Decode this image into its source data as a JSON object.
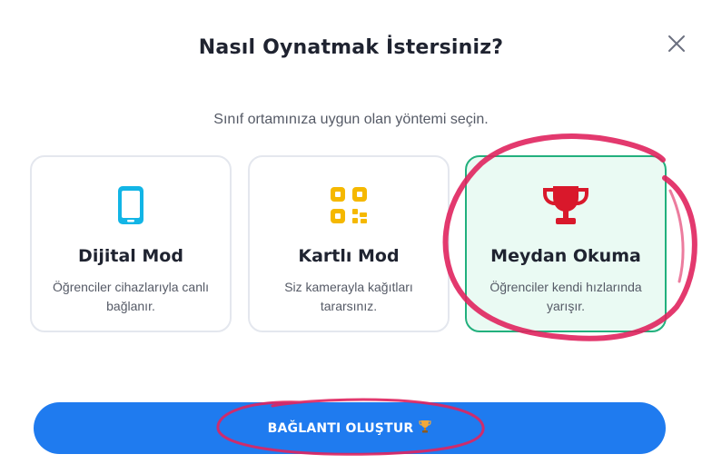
{
  "dialog": {
    "title": "Nasıl Oynatmak İstersiniz?",
    "subtitle": "Sınıf ortamınıza uygun olan yöntemi seçin."
  },
  "modes": [
    {
      "title": "Dijital Mod",
      "description": "Öğrenciler cihazlarıyla canlı bağlanır.",
      "icon": "phone-icon",
      "selected": false
    },
    {
      "title": "Kartlı Mod",
      "description": "Siz kamerayla kağıtları tararsınız.",
      "icon": "qr-code-icon",
      "selected": false
    },
    {
      "title": "Meydan Okuma",
      "description": "Öğrenciler kendi hızlarında yarışır.",
      "icon": "trophy-icon",
      "selected": true
    }
  ],
  "cta": {
    "label": "BAĞLANTI OLUŞTUR",
    "icon": "trophy-emoji-icon"
  },
  "colors": {
    "primary": "#1f7bef",
    "selected_border": "#22b07d",
    "selected_bg": "#eafaf3",
    "phone_icon": "#12b5e6",
    "qr_icon": "#f5b800",
    "trophy_icon": "#d9182b",
    "annotation": "#e0245e"
  }
}
